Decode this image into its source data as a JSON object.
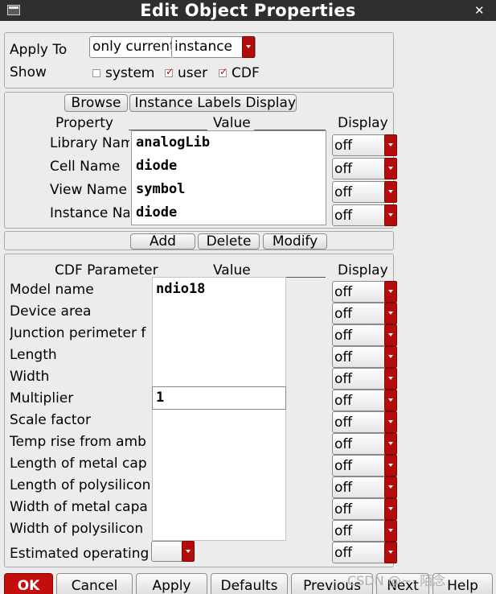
{
  "window": {
    "title": "Edit Object Properties",
    "close_glyph": "✕"
  },
  "apply_to": {
    "label": "Apply To",
    "scope_value": "only current",
    "object_value": "instance"
  },
  "show": {
    "label": "Show",
    "options": [
      {
        "label": "system",
        "checked": false
      },
      {
        "label": "user",
        "checked": true
      },
      {
        "label": "CDF",
        "checked": true
      }
    ]
  },
  "browse_button": "Browse",
  "labels_button": "Reset Instance Labels Display",
  "property_table": {
    "property_header": "Property",
    "value_header": "Value",
    "display_header": "Display",
    "rows": [
      {
        "name": "Library Name",
        "value": "analogLib",
        "display": "off"
      },
      {
        "name": "Cell Name",
        "value": "diode",
        "display": "off"
      },
      {
        "name": "View Name",
        "value": "symbol",
        "display": "off"
      },
      {
        "name": "Instance Name",
        "value": "diode",
        "display": "off"
      }
    ]
  },
  "actions": {
    "add": "Add",
    "delete": "Delete",
    "modify": "Modify"
  },
  "cdf_table": {
    "param_header": "CDF Parameter",
    "value_header": "Value",
    "display_header": "Display",
    "rows": [
      {
        "name": "Model name",
        "value": "ndio18",
        "display": "off"
      },
      {
        "name": "Device area",
        "value": "",
        "display": "off"
      },
      {
        "name": "Junction perimeter f",
        "value": "",
        "display": "off"
      },
      {
        "name": "Length",
        "value": "",
        "display": "off"
      },
      {
        "name": "Width",
        "value": "",
        "display": "off"
      },
      {
        "name": "Multiplier",
        "value": "1",
        "display": "off"
      },
      {
        "name": "Scale factor",
        "value": "",
        "display": "off"
      },
      {
        "name": "Temp rise from amb",
        "value": "",
        "display": "off"
      },
      {
        "name": "Length of metal cap",
        "value": "",
        "display": "off"
      },
      {
        "name": "Length of polysilicon",
        "value": "",
        "display": "off"
      },
      {
        "name": "Width of metal capa",
        "value": "",
        "display": "off"
      },
      {
        "name": "Width of polysilicon",
        "value": "",
        "display": "off"
      }
    ],
    "estimated_label": "Estimated operating",
    "estimated_display": "off"
  },
  "bottom_buttons": {
    "ok": "OK",
    "cancel": "Cancel",
    "apply": "Apply",
    "defaults": "Defaults",
    "previous": "Previous",
    "next": "Next",
    "help": "Help"
  },
  "watermark": "CSDN @~· 陌念",
  "colors": {
    "accent_red": "#b40b0b",
    "title_bar": "#2f2f2f",
    "dialog_bg": "#ececec"
  }
}
